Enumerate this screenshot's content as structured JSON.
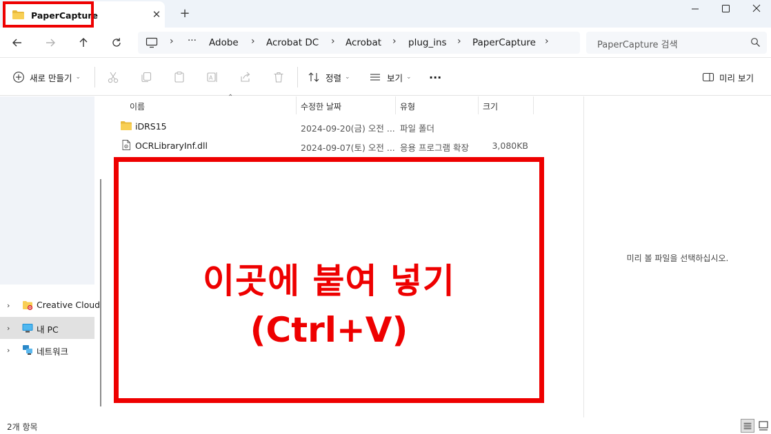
{
  "tab": {
    "title": "PaperCapture",
    "close_glyph": "✕",
    "new_tab_glyph": "+"
  },
  "icons": {
    "folder": "folder-icon",
    "dll": "dll-file-icon",
    "window_controls": [
      "minimize-icon",
      "maximize-icon",
      "close-icon"
    ]
  },
  "breadcrumb": {
    "overflow": "···",
    "separator": "›",
    "items": [
      "Adobe",
      "Acrobat DC",
      "Acrobat",
      "plug_ins",
      "PaperCapture"
    ]
  },
  "search": {
    "placeholder": "PaperCapture 검색"
  },
  "commands": {
    "new": "새로 만들기",
    "sort": "정렬",
    "view": "보기",
    "more": "···",
    "preview": "미리 보기"
  },
  "nav": {
    "chevron": "›",
    "items": [
      {
        "label": "Creative Cloud",
        "selected": false
      },
      {
        "label": "내 PC",
        "selected": true
      },
      {
        "label": "네트워크",
        "selected": false
      }
    ]
  },
  "columns": {
    "name": "이름",
    "modified": "수정한 날짜",
    "type": "유형",
    "size": "크기"
  },
  "files": [
    {
      "name": "iDRS15",
      "modified": "2024-09-20(금) 오전 ...",
      "type": "파일 폴더",
      "size": "",
      "kind": "folder"
    },
    {
      "name": "OCRLibraryInf.dll",
      "modified": "2024-09-07(토) 오전 ...",
      "type": "응용 프로그램 확장",
      "size": "3,080KB",
      "kind": "dll"
    }
  ],
  "annotation": {
    "line1": "이곳에 붙여 넣기",
    "line2": "(Ctrl+V)",
    "color": "#ee0000"
  },
  "preview_pane": {
    "message": "미리 볼 파일을 선택하십시오."
  },
  "status": {
    "item_count": "2개 항목"
  }
}
